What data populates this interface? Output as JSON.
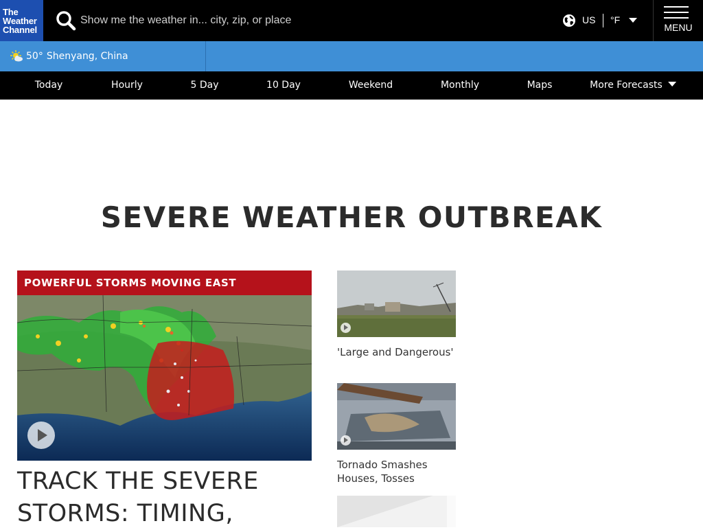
{
  "brand": {
    "logo_lines": [
      "The",
      "Weather",
      "Channel"
    ]
  },
  "search": {
    "placeholder": "Show me the weather in... city, zip, or place"
  },
  "units": {
    "region": "US",
    "temp": "°F"
  },
  "menu": {
    "label": "MENU"
  },
  "location": {
    "temp": "50°",
    "place": "Shenyang, China"
  },
  "nav": {
    "items": [
      "Today",
      "Hourly",
      "5 Day",
      "10 Day",
      "Weekend",
      "Monthly",
      "Maps",
      "More Forecasts"
    ]
  },
  "section": {
    "title": "SEVERE WEATHER OUTBREAK"
  },
  "feature": {
    "kicker": "POWERFUL STORMS MOVING EAST",
    "headline": "TRACK THE SEVERE STORMS: TIMING,"
  },
  "cards": [
    {
      "title": "'Large and Dangerous'"
    },
    {
      "title": "Tornado Smashes Houses, Tosses"
    },
    {
      "title": ""
    }
  ],
  "colors": {
    "header": "#000000",
    "logo": "#1d4fb0",
    "location_bar": "#3f8fd6",
    "kicker": "#b5121b"
  }
}
